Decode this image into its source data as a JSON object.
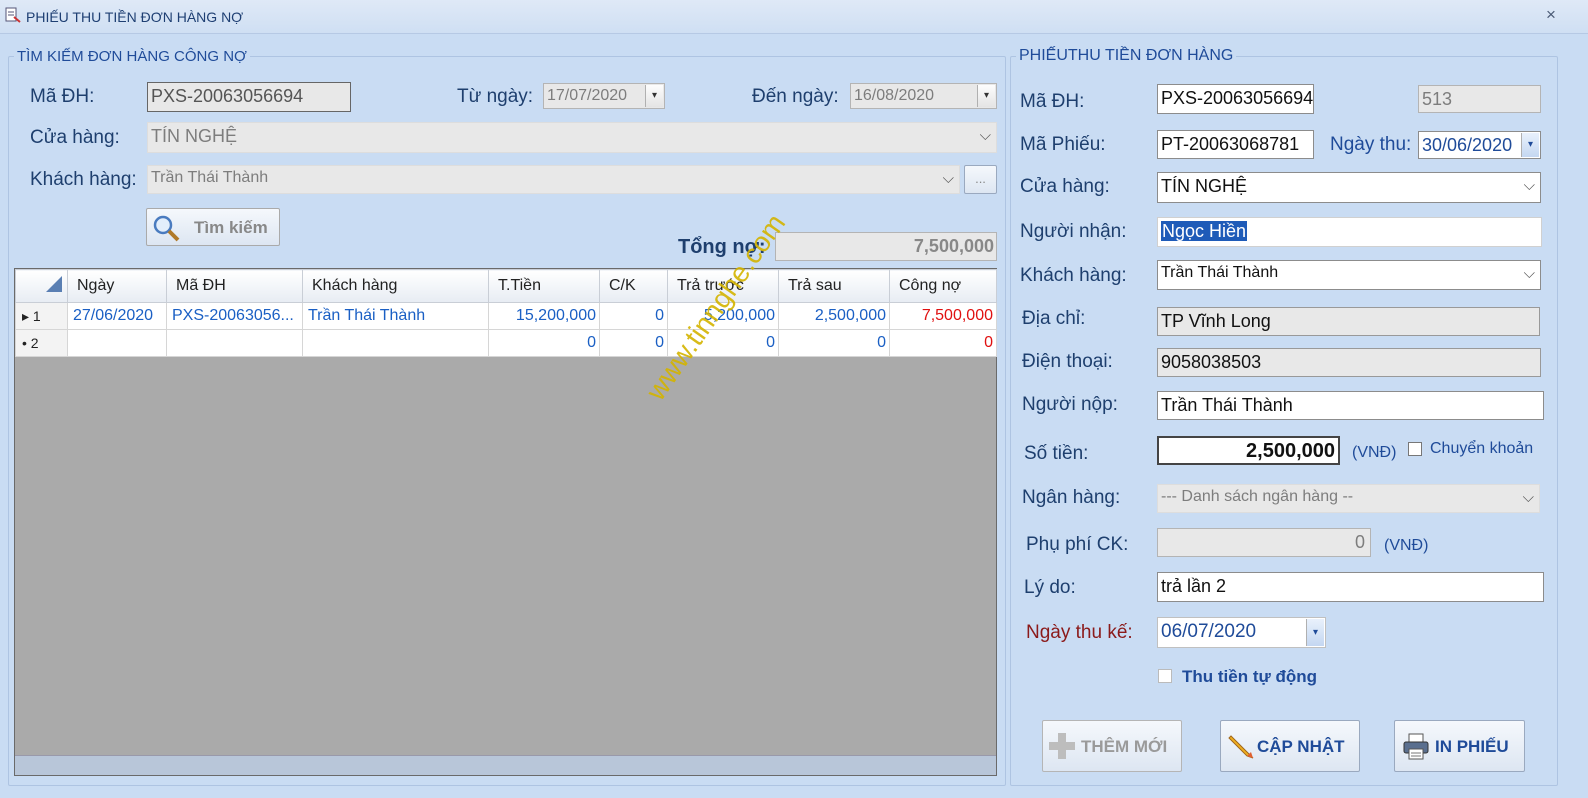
{
  "window": {
    "title": "PHIẾU THU TIỀN ĐƠN HÀNG NỢ",
    "close": "×"
  },
  "search": {
    "group_title": "TÌM KIẾM ĐƠN HÀNG CÔNG NỢ",
    "ma_dh_label": "Mã ĐH:",
    "ma_dh_value": "PXS-20063056694",
    "tu_ngay_label": "Từ ngày:",
    "tu_ngay_value": "17/07/2020",
    "den_ngay_label": "Đến ngày:",
    "den_ngay_value": "16/08/2020",
    "cua_hang_label": "Cửa hàng:",
    "cua_hang_value": "TÍN NGHỆ",
    "khach_hang_label": "Khách hàng:",
    "khach_hang_value": "Trần Thái Thành",
    "ellipsis": "...",
    "search_button": "Tìm kiếm",
    "tong_no_label": "Tổng nợ:",
    "tong_no_value": "7,500,000"
  },
  "grid": {
    "columns": [
      "Ngày",
      "Mã ĐH",
      "Khách hàng",
      "T.Tiền",
      "C/K",
      "Trả trước",
      "Trả sau",
      "Công nợ"
    ],
    "rows": [
      {
        "marker": "▸ 1",
        "ngay": "27/06/2020",
        "ma_dh": "PXS-20063056...",
        "khach_hang": "Trần Thái Thành",
        "t_tien": "15,200,000",
        "ck": "0",
        "tra_truoc": "5,200,000",
        "tra_sau": "2,500,000",
        "cong_no": "7,500,000"
      },
      {
        "marker": "• 2",
        "ngay": "",
        "ma_dh": "",
        "khach_hang": "",
        "t_tien": "0",
        "ck": "0",
        "tra_truoc": "0",
        "tra_sau": "0",
        "cong_no": "0"
      }
    ]
  },
  "watermark": "www.tinnghe.com",
  "receipt": {
    "group_title": "PHIẾUTHU TIỀN ĐƠN HÀNG",
    "ma_dh_label": "Mã ĐH:",
    "ma_dh_value": "PXS-20063056694",
    "id_value": "513",
    "ma_phieu_label": "Mã Phiếu:",
    "ma_phieu_value": "PT-20063068781",
    "ngay_thu_label": "Ngày thu:",
    "ngay_thu_value": "30/06/2020",
    "cua_hang_label": "Cửa hàng:",
    "cua_hang_value": "TÍN NGHỆ",
    "nguoi_nhan_label": "Người nhận:",
    "nguoi_nhan_value": "Ngọc Hiền",
    "khach_hang_label": "Khách hàng:",
    "khach_hang_value": "Trần Thái Thành",
    "dia_chi_label": "Địa chỉ:",
    "dia_chi_value": "TP Vĩnh Long",
    "dien_thoai_label": "Điện thoại:",
    "dien_thoai_value": "9058038503",
    "nguoi_nop_label": "Người nộp:",
    "nguoi_nop_value": "Trần Thái Thành",
    "so_tien_label": "Số tiền:",
    "so_tien_value": "2,500,000",
    "vnd": "(VNĐ)",
    "chuyen_khoan_label": "Chuyển khoản",
    "ngan_hang_label": "Ngân hàng:",
    "ngan_hang_value": "--- Danh sách ngân hàng --",
    "phu_phi_label": "Phụ phí CK:",
    "phu_phi_value": "0",
    "ly_do_label": "Lý do:",
    "ly_do_value": "trả lần 2",
    "ngay_thu_ke_label": "Ngày thu kế:",
    "ngay_thu_ke_value": "06/07/2020",
    "thu_tien_tu_dong_label": "Thu tiền tự động",
    "btn_them_moi": "THÊM MỚI",
    "btn_cap_nhat": "CẬP NHẬT",
    "btn_in_phieu": "IN PHIẾU"
  },
  "colors": {
    "accent": "#1f4b99",
    "background": "#c9dcf3",
    "debt_red": "#e01010",
    "link_blue": "#1a5fc4"
  }
}
